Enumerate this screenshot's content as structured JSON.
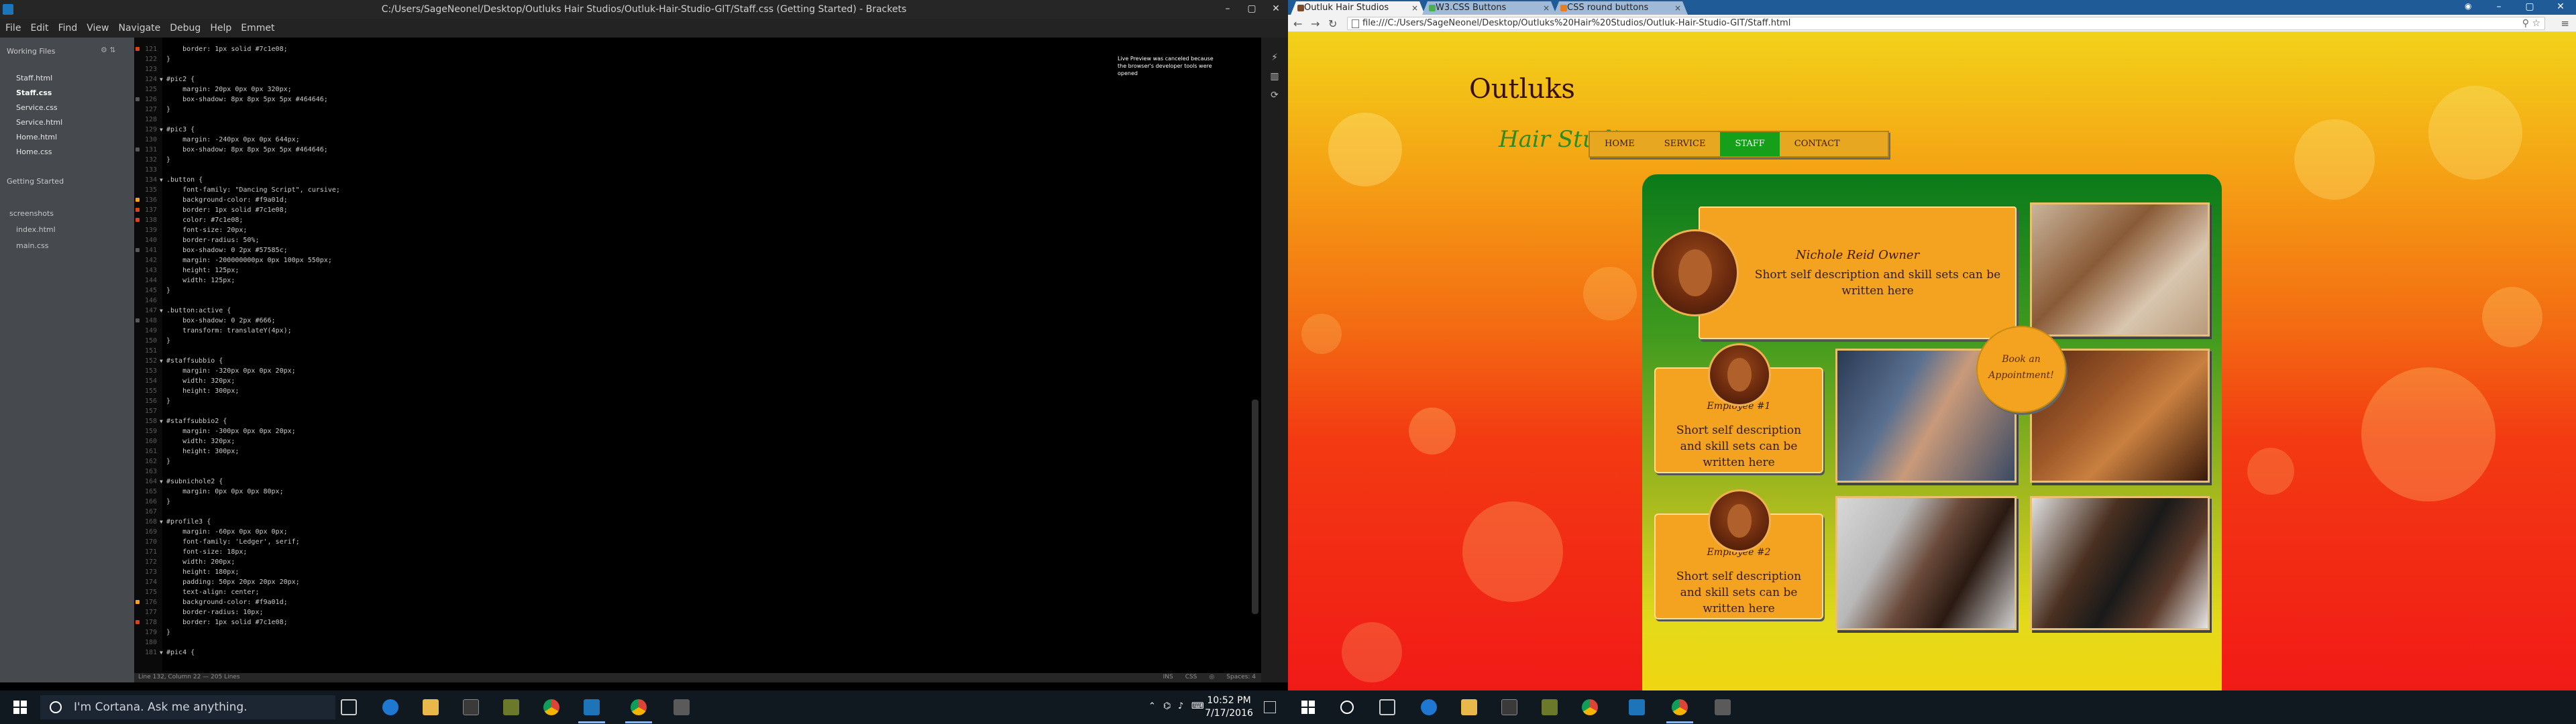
{
  "brackets": {
    "title": "C:/Users/SageNeonel/Desktop/Outluks Hair Studios/Outluk-Hair-Studio-GIT/Staff.css (Getting Started) - Brackets",
    "menu": [
      "File",
      "Edit",
      "Find",
      "View",
      "Navigate",
      "Debug",
      "Help",
      "Emmet"
    ],
    "working_files_label": "Working Files",
    "working_files": [
      "Staff.html",
      "Staff.css",
      "Service.css",
      "Service.html",
      "Home.html",
      "Home.css"
    ],
    "active_file": "Staff.css",
    "project_label": "Getting Started",
    "project_items": [
      "screenshots",
      "index.html",
      "main.css"
    ],
    "live_preview_note": "Live Preview was canceled because the browser's developer tools were opened",
    "status_left": "Line 132, Column 22 — 205 Lines",
    "status_ins": "INS",
    "status_lang": "CSS",
    "status_spaces": "Spaces: 4",
    "code_lines": [
      {
        "n": "121",
        "t": "    border: 1px solid #7c1e08;",
        "m": "red"
      },
      {
        "n": "122",
        "t": "}"
      },
      {
        "n": "123",
        "t": ""
      },
      {
        "n": "124",
        "t": "#pic2 {",
        "f": true
      },
      {
        "n": "125",
        "t": "    margin: 20px 0px 0px 320px;"
      },
      {
        "n": "126",
        "t": "    box-shadow: 8px 8px 5px 5px #464646;",
        "m": "gray"
      },
      {
        "n": "127",
        "t": "}"
      },
      {
        "n": "128",
        "t": ""
      },
      {
        "n": "129",
        "t": "#pic3 {",
        "f": true
      },
      {
        "n": "130",
        "t": "    margin: -240px 0px 0px 644px;"
      },
      {
        "n": "131",
        "t": "    box-shadow: 8px 8px 5px 5px #464646;",
        "m": "gray"
      },
      {
        "n": "132",
        "t": "}"
      },
      {
        "n": "133",
        "t": ""
      },
      {
        "n": "134",
        "t": ".button {",
        "f": true
      },
      {
        "n": "135",
        "t": "    font-family: \"Dancing Script\", cursive;"
      },
      {
        "n": "136",
        "t": "    background-color: #f9a01d;",
        "m": "orange"
      },
      {
        "n": "137",
        "t": "    border: 1px solid #7c1e08;",
        "m": "red"
      },
      {
        "n": "138",
        "t": "    color: #7c1e08;",
        "m": "red"
      },
      {
        "n": "139",
        "t": "    font-size: 20px;"
      },
      {
        "n": "140",
        "t": "    border-radius: 50%;"
      },
      {
        "n": "141",
        "t": "    box-shadow: 0 2px #57585c;",
        "m": "gray"
      },
      {
        "n": "142",
        "t": "    margin: -200000000px 0px 100px 550px;"
      },
      {
        "n": "143",
        "t": "    height: 125px;"
      },
      {
        "n": "144",
        "t": "    width: 125px;"
      },
      {
        "n": "145",
        "t": "}"
      },
      {
        "n": "146",
        "t": ""
      },
      {
        "n": "147",
        "t": ".button:active {",
        "f": true
      },
      {
        "n": "148",
        "t": "    box-shadow: 0 2px #666;",
        "m": "gray"
      },
      {
        "n": "149",
        "t": "    transform: translateY(4px);"
      },
      {
        "n": "150",
        "t": "}"
      },
      {
        "n": "151",
        "t": ""
      },
      {
        "n": "152",
        "t": "#staffsubbio {",
        "f": true
      },
      {
        "n": "153",
        "t": "    margin: -320px 0px 0px 20px;"
      },
      {
        "n": "154",
        "t": "    width: 320px;"
      },
      {
        "n": "155",
        "t": "    height: 300px;"
      },
      {
        "n": "156",
        "t": "}"
      },
      {
        "n": "157",
        "t": ""
      },
      {
        "n": "158",
        "t": "#staffsubbio2 {",
        "f": true
      },
      {
        "n": "159",
        "t": "    margin: -300px 0px 0px 20px;"
      },
      {
        "n": "160",
        "t": "    width: 320px;"
      },
      {
        "n": "161",
        "t": "    height: 300px;"
      },
      {
        "n": "162",
        "t": "}"
      },
      {
        "n": "163",
        "t": ""
      },
      {
        "n": "164",
        "t": "#subnichole2 {",
        "f": true
      },
      {
        "n": "165",
        "t": "    margin: 0px 0px 0px 80px;"
      },
      {
        "n": "166",
        "t": "}"
      },
      {
        "n": "167",
        "t": ""
      },
      {
        "n": "168",
        "t": "#profile3 {",
        "f": true
      },
      {
        "n": "169",
        "t": "    margin: -60px 0px 0px 0px;"
      },
      {
        "n": "170",
        "t": "    font-family: 'Ledger', serif;"
      },
      {
        "n": "171",
        "t": "    font-size: 18px;"
      },
      {
        "n": "172",
        "t": "    width: 200px;"
      },
      {
        "n": "173",
        "t": "    height: 180px;"
      },
      {
        "n": "174",
        "t": "    padding: 50px 20px 20px 20px;"
      },
      {
        "n": "175",
        "t": "    text-align: center;"
      },
      {
        "n": "176",
        "t": "    background-color: #f9a01d;",
        "m": "orange"
      },
      {
        "n": "177",
        "t": "    border-radius: 10px;"
      },
      {
        "n": "178",
        "t": "    border: 1px solid #7c1e08;",
        "m": "red"
      },
      {
        "n": "179",
        "t": "}"
      },
      {
        "n": "180",
        "t": ""
      },
      {
        "n": "181",
        "t": "#pic4 {",
        "f": true
      }
    ]
  },
  "chrome": {
    "tabs": [
      {
        "title": "Outluk Hair Studios",
        "favicon": "#7a4a2a",
        "active": true
      },
      {
        "title": "W3.CSS Buttons",
        "favicon": "#4caf50",
        "active": false
      },
      {
        "title": "CSS round buttons",
        "favicon": "#e67e22",
        "active": false
      }
    ],
    "address": "file:///C:/Users/SageNeonel/Desktop/Outluks%20Hair%20Studios/Outluk-Hair-Studio-GIT/Staff.html",
    "page": {
      "logo_top": "Outluks",
      "logo_bottom": "Hair Studios",
      "nav": [
        "HOME",
        "SERVICE",
        "STAFF",
        "CONTACT"
      ],
      "nav_active": "STAFF",
      "owner_name": "Nichole Reid Owner",
      "owner_desc": "Short self description and skill sets can be written here",
      "employee1_name": "Employee #1",
      "employee1_desc": "Short self description and skill sets can be written here",
      "employee2_name": "Employee #2",
      "employee2_desc": "Short self description and skill sets can be written here",
      "book_button": "Book an Appointment!",
      "colors": {
        "panel_green": "#0a7a1a",
        "box_orange": "#f4a320",
        "nav_active": "#16a01a"
      }
    }
  },
  "taskbar": {
    "cortana_placeholder": "I'm Cortana. Ask me anything.",
    "time": "10:52 PM",
    "date": "7/17/2016"
  }
}
